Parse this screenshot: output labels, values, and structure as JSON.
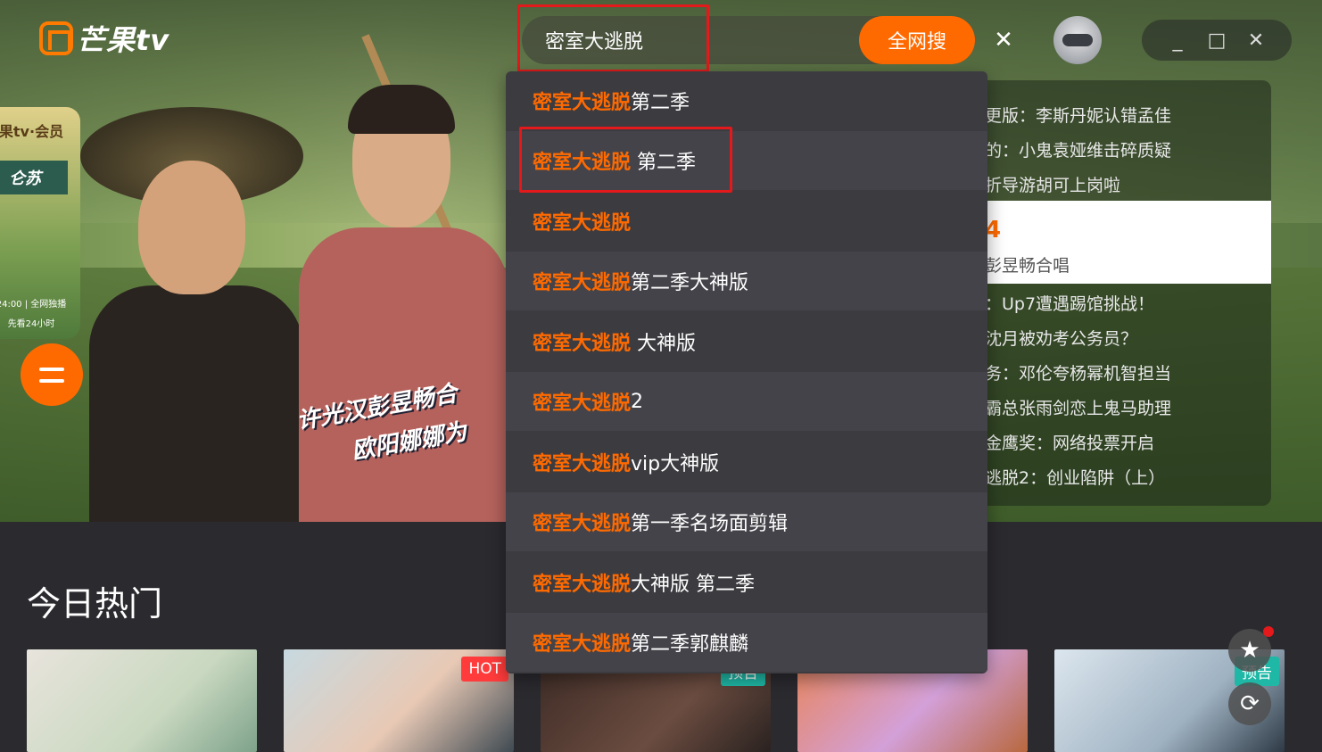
{
  "app": {
    "logo_text": "芒果tv"
  },
  "search": {
    "value": "密室大逃脱",
    "button_label": "全网搜",
    "clear_icon": "close-icon"
  },
  "window_controls": {
    "minimize": "_",
    "maximize": "□",
    "close": "✕"
  },
  "hero": {
    "promo_vip": "果tv·会员",
    "promo_brand": "仑苏",
    "promo_time": "24:00 | 全网独播",
    "promo_early": "先看24小时",
    "caption_line1": "许光汉彭昱畅合",
    "caption_line2": "欧阳娜娜为"
  },
  "news": {
    "items": [
      "更版：李斯丹妮认错孟佳",
      "的：小鬼袁娅维击碎质疑",
      "折导游胡可上岗啦",
      "：Up7遭遇踢馆挑战！",
      "沈月被劝考公务员？",
      "务：邓伦夸杨幂机智担当",
      "霸总张雨剑恋上鬼马助理",
      "金鹰奖：网络投票开启",
      "逃脱2：创业陷阱（上）"
    ],
    "active": {
      "num": "4",
      "sub": "彭昱畅合唱"
    }
  },
  "suggestions": [
    {
      "highlight": "密室大逃脱",
      "rest": "第二季"
    },
    {
      "highlight": "密室大逃脱",
      "rest": " 第二季"
    },
    {
      "highlight": "密室大逃脱",
      "rest": ""
    },
    {
      "highlight": "密室大逃脱",
      "rest": "第二季大神版"
    },
    {
      "highlight": "密室大逃脱",
      "rest": " 大神版"
    },
    {
      "highlight": "密室大逃脱",
      "rest": "2"
    },
    {
      "highlight": "密室大逃脱",
      "rest": "vip大神版"
    },
    {
      "highlight": "密室大逃脱",
      "rest": "第一季名场面剪辑"
    },
    {
      "highlight": "密室大逃脱",
      "rest": "大神版 第二季"
    },
    {
      "highlight": "密室大逃脱",
      "rest": "第二季郭麒麟"
    }
  ],
  "section": {
    "title": "今日热门"
  },
  "thumbnails": [
    {
      "badge": "",
      "badge_color": ""
    },
    {
      "badge": "HOT",
      "badge_color": "#ff3b3b"
    },
    {
      "badge": "预告",
      "badge_color": "#1fb8a6"
    },
    {
      "badge": "",
      "badge_color": ""
    },
    {
      "badge": "预告",
      "badge_color": "#1fb8a6"
    }
  ],
  "fabs": {
    "favorite_icon": "star-icon",
    "refresh_icon": "refresh-icon"
  },
  "colors": {
    "accent": "#ff6a00",
    "annotation": "#e3191b",
    "dropdown_bg": "#3c3b40"
  }
}
